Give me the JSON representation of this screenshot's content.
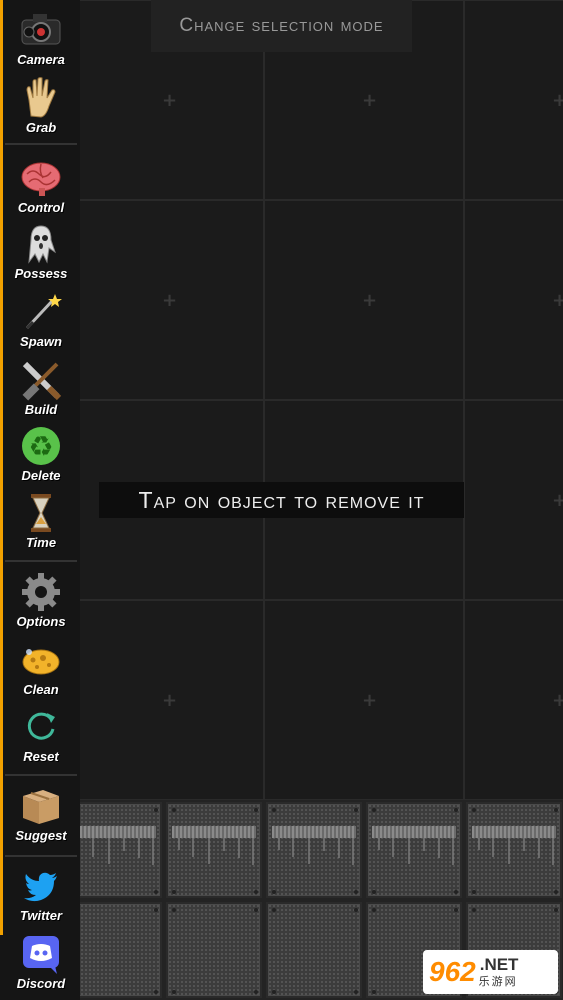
{
  "top_banner": {
    "text": "Change selection mode"
  },
  "center_message": {
    "text": "Tap on object to remove it"
  },
  "sidebar": {
    "accent_color": "#f2a100",
    "tools": [
      {
        "label": "Camera",
        "icon": "camera-icon"
      },
      {
        "label": "Grab",
        "icon": "hand-icon"
      },
      {
        "label": "Control",
        "icon": "brain-icon"
      },
      {
        "label": "Possess",
        "icon": "ghost-icon"
      },
      {
        "label": "Spawn",
        "icon": "magic-wand-icon"
      },
      {
        "label": "Build",
        "icon": "saw-hammer-icon"
      },
      {
        "label": "Delete",
        "icon": "recycle-icon"
      },
      {
        "label": "Time",
        "icon": "hourglass-icon"
      },
      {
        "label": "Options",
        "icon": "gear-icon"
      },
      {
        "label": "Clean",
        "icon": "sponge-icon"
      },
      {
        "label": "Reset",
        "icon": "reset-icon"
      },
      {
        "label": "Suggest",
        "icon": "box-icon"
      },
      {
        "label": "Twitter",
        "icon": "twitter-icon"
      },
      {
        "label": "Discord",
        "icon": "discord-icon"
      }
    ]
  },
  "watermark": {
    "number": "962",
    "suffix": ".NET",
    "chinese": "乐游网"
  }
}
